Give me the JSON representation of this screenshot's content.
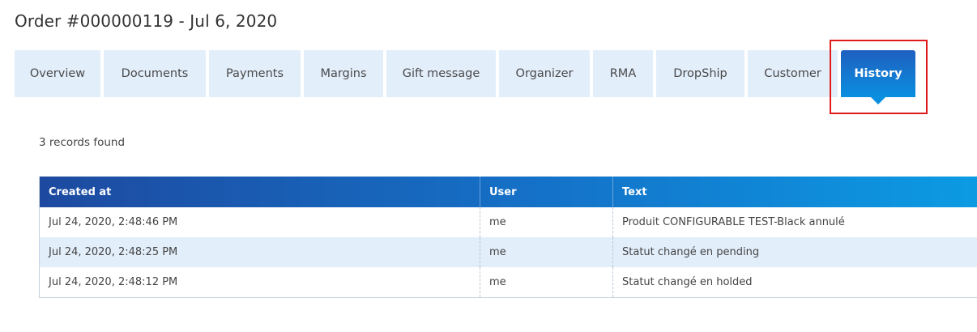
{
  "page": {
    "title": "Order #000000119 - Jul 6, 2020"
  },
  "tabs": [
    {
      "label": "Overview"
    },
    {
      "label": "Documents"
    },
    {
      "label": "Payments"
    },
    {
      "label": "Margins"
    },
    {
      "label": "Gift message"
    },
    {
      "label": "Organizer"
    },
    {
      "label": "RMA"
    },
    {
      "label": "DropShip"
    },
    {
      "label": "Customer"
    },
    {
      "label": "History",
      "active": true
    }
  ],
  "history": {
    "records_text": "3 records found",
    "columns": [
      "Created at",
      "User",
      "Text"
    ],
    "rows": [
      {
        "created_at": "Jul 24, 2020, 2:48:46 PM",
        "user": "me",
        "text": "Produit CONFIGURABLE TEST-Black annulé"
      },
      {
        "created_at": "Jul 24, 2020, 2:48:25 PM",
        "user": "me",
        "text": "Statut changé en pending"
      },
      {
        "created_at": "Jul 24, 2020, 2:48:12 PM",
        "user": "me",
        "text": "Statut changé en holded"
      }
    ]
  },
  "colors": {
    "tab_bg": "#e3eefb",
    "active_tab_start": "#1f5fbf",
    "active_tab_end": "#0a8fe0",
    "highlight_border": "#e01b1b"
  }
}
